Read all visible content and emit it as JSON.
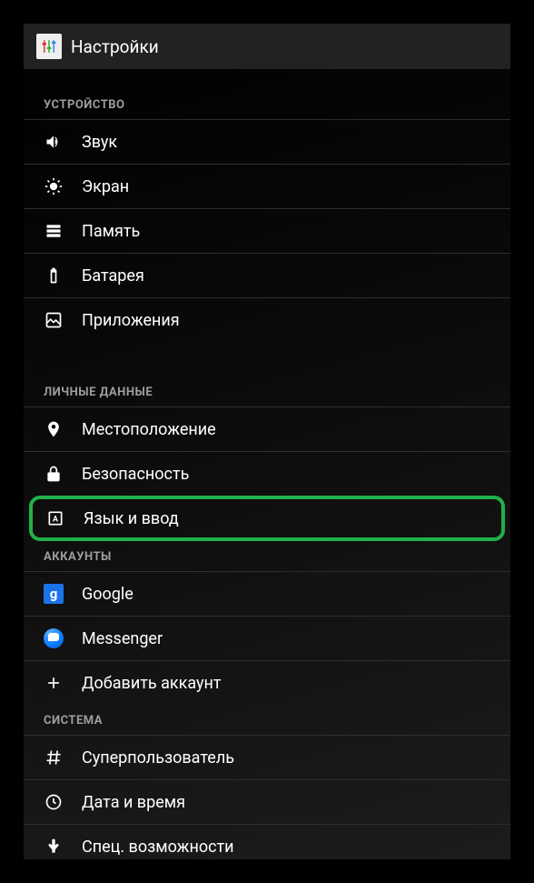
{
  "header": {
    "title": "Настройки"
  },
  "sections": {
    "device": {
      "header": "УСТРОЙСТВО",
      "items": {
        "sound": "Звук",
        "display": "Экран",
        "storage": "Память",
        "battery": "Батарея",
        "apps": "Приложения"
      }
    },
    "personal": {
      "header": "ЛИЧНЫЕ ДАННЫЕ",
      "items": {
        "location": "Местоположение",
        "security": "Безопасность",
        "language": "Язык и ввод"
      }
    },
    "accounts": {
      "header": "АККАУНТЫ",
      "items": {
        "google": "Google",
        "messenger": "Messenger",
        "add": "Добавить аккаунт"
      }
    },
    "system": {
      "header": "СИСТЕМА",
      "items": {
        "superuser": "Суперпользователь",
        "datetime": "Дата и время",
        "accessibility": "Спец. возможности"
      }
    }
  }
}
